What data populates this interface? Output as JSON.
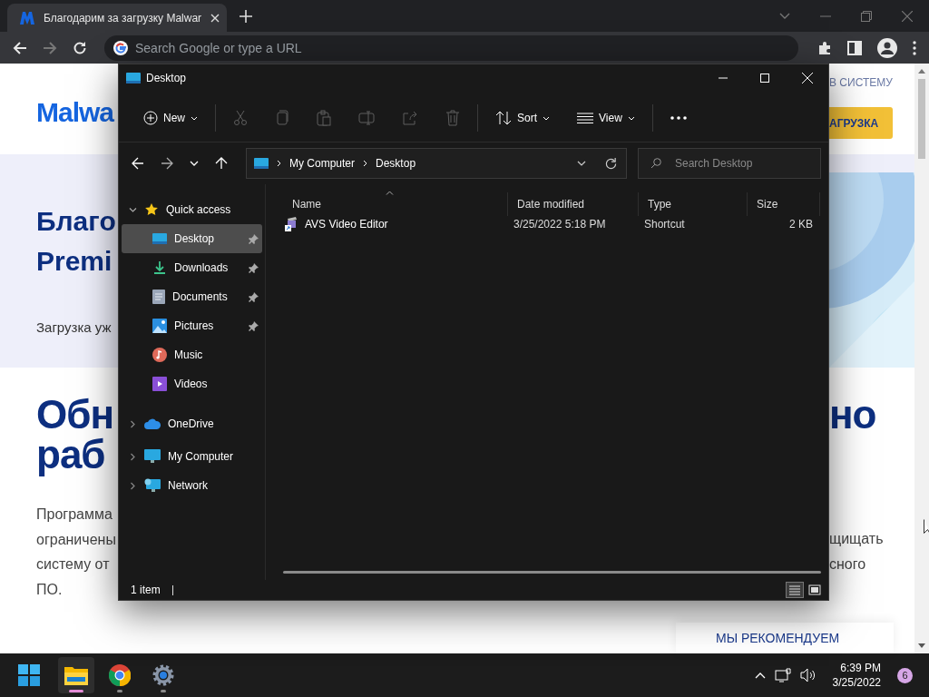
{
  "browser": {
    "tabs": [
      {
        "title": "Благодарим за загрузку Malwar",
        "selected": true
      }
    ],
    "forward_disabled": true,
    "omnibox": {
      "placeholder": "Search Google or type a URL"
    }
  },
  "web_page": {
    "login_link": "В СИСТЕМУ",
    "logo": "Malwa",
    "download_button": "АГРУЗКА",
    "hero_heading_lines": [
      "Благо",
      "Premi"
    ],
    "hero_text": "Загрузка уж",
    "section_heading_lines": [
      "Обн",
      "раб"
    ],
    "section_heading_right": "но",
    "paragraph_lines": [
      "Программа",
      "ограничены",
      "систему от",
      "ПО."
    ],
    "paragraph_right_lines": [
      "щищать",
      "сного"
    ],
    "recommend_label": "МЫ РЕКОМЕНДУЕМ"
  },
  "explorer": {
    "title": "Desktop",
    "command_groups": [
      [
        {
          "kind": "new",
          "label": "New",
          "disabled": false
        }
      ],
      [
        {
          "kind": "cut",
          "disabled": true
        },
        {
          "kind": "copy",
          "disabled": true
        },
        {
          "kind": "paste",
          "disabled": true
        },
        {
          "kind": "rename",
          "disabled": true
        },
        {
          "kind": "share",
          "disabled": true
        },
        {
          "kind": "delete",
          "disabled": true
        }
      ],
      [
        {
          "kind": "sort",
          "label": "Sort",
          "disabled": false
        },
        {
          "kind": "view",
          "label": "View",
          "disabled": false
        }
      ],
      [
        {
          "kind": "more",
          "disabled": false
        }
      ]
    ],
    "address": {
      "crumbs": [
        "My Computer",
        "Desktop"
      ]
    },
    "search": {
      "placeholder": "Search Desktop"
    },
    "nav": [
      {
        "label": "Quick access",
        "kind": "star",
        "expanded": true,
        "selected": false,
        "children": [
          {
            "label": "Desktop",
            "kind": "desktop",
            "pinned": true,
            "selected": true
          },
          {
            "label": "Downloads",
            "kind": "downloads",
            "pinned": true,
            "selected": false
          },
          {
            "label": "Documents",
            "kind": "documents",
            "pinned": true,
            "selected": false
          },
          {
            "label": "Pictures",
            "kind": "pictures",
            "pinned": true,
            "selected": false
          },
          {
            "label": "Music",
            "kind": "music",
            "pinned": false,
            "selected": false
          },
          {
            "label": "Videos",
            "kind": "videos",
            "pinned": false,
            "selected": false
          }
        ]
      },
      {
        "label": "OneDrive",
        "kind": "cloud",
        "expanded": false,
        "selected": false
      },
      {
        "label": "My Computer",
        "kind": "computer",
        "expanded": false,
        "selected": false
      },
      {
        "label": "Network",
        "kind": "network",
        "expanded": false,
        "selected": false
      }
    ],
    "columns": [
      {
        "label": "Name",
        "sorted": true
      },
      {
        "label": "Date modified",
        "sorted": false
      },
      {
        "label": "Type",
        "sorted": false
      },
      {
        "label": "Size",
        "sorted": false
      }
    ],
    "files": [
      {
        "name": "AVS Video Editor",
        "date": "3/25/2022 5:18 PM",
        "type": "Shortcut",
        "size": "2 KB"
      }
    ],
    "status": "1 item",
    "view_buttons": [
      {
        "kind": "details",
        "selected": true
      },
      {
        "kind": "tiles",
        "selected": false
      }
    ]
  },
  "taskbar": {
    "apps": [
      {
        "kind": "explorer",
        "active": true
      },
      {
        "kind": "chrome",
        "active": false
      },
      {
        "kind": "settings",
        "active": false
      }
    ],
    "time": "6:39 PM",
    "date": "3/25/2022",
    "notifications": "6"
  }
}
